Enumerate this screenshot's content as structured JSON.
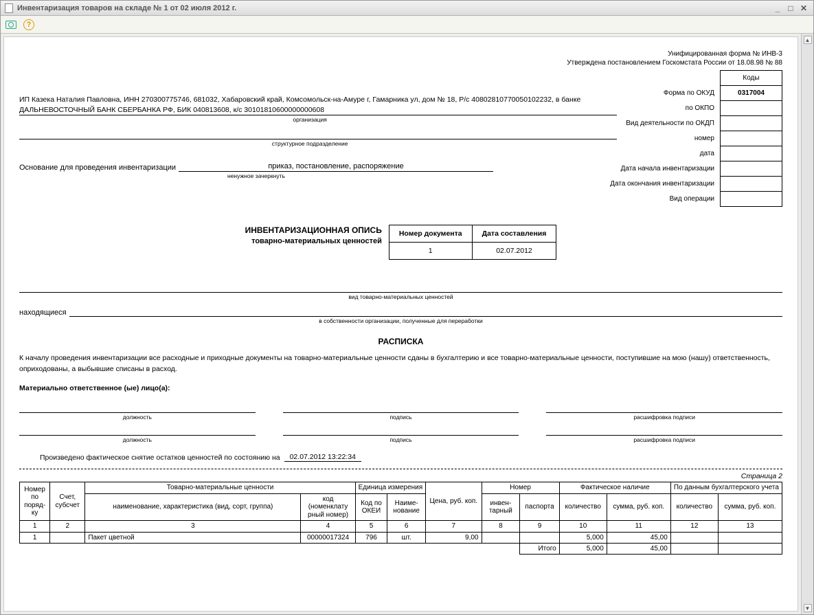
{
  "window": {
    "title": "Инвентаризация товаров на складе № 1 от 02 июля 2012 г."
  },
  "header": {
    "form_line1": "Унифицированная форма № ИНВ-3",
    "form_line2": "Утверждена постановлением Госкомстата России от 18.08.98 № 88"
  },
  "codes": {
    "title": "Коды",
    "okud_label": "Форма по ОКУД",
    "okud": "0317004",
    "okpo_label": "по ОКПО",
    "okpo": "",
    "okdp_label": "Вид деятельности по ОКДП",
    "okdp": "",
    "number_label": "номер",
    "number": "",
    "date_label": "дата",
    "date": "",
    "start_label": "Дата начала инвентаризации",
    "start": "",
    "end_label": "Дата окончания инвентаризации",
    "end": "",
    "oper_label": "Вид операции",
    "oper": ""
  },
  "org": {
    "text": "ИП Казека Наталия Павловна, ИНН 270300775746, 681032, Хабаровский край, Комсомольск-на-Амуре г, Гамарника ул, дом № 18, Р/с 40802810770050102232, в банке ДАЛЬНЕВОСТОЧНЫЙ БАНК СБЕРБАНКА РФ, БИК 040813608, к/с 30101810600000000608",
    "org_cap": "организация",
    "dept_cap": "структурное подразделение"
  },
  "basis": {
    "label": "Основание для проведения инвентаризации",
    "value": "приказ, постановление, распоряжение",
    "cap": "ненужное зачеркнуть"
  },
  "doc_head": {
    "title": "ИНВЕНТАРИЗАЦИОННАЯ ОПИСЬ",
    "subtitle": "товарно-материальных ценностей",
    "num_hdr": "Номер документа",
    "date_hdr": "Дата составления",
    "num": "1",
    "date": "02.07.2012"
  },
  "mid": {
    "type_cap": "вид товарно-материальных ценностей",
    "located": "находящиеся",
    "located_cap": "в собственности организации, полученные для переработки"
  },
  "raspiska": {
    "title": "РАСПИСКА",
    "text": "К началу проведения инвентаризации все расходные и приходные документы на товарно-материальные ценности сданы в бухгалтерию и все товарно-материальные ценности, поступившие на мою (нашу) ответственность, оприходованы, а выбывшие списаны в расход.",
    "resp_label": "Материально ответственное (ые) лицо(а):",
    "pos_cap": "должность",
    "sign_cap": "подпись",
    "name_cap": "расшифровка подписи",
    "state_label": "Произведено фактическое снятие остатков ценностей по состоянию на",
    "state_value": "02.07.2012 13:22:34"
  },
  "page_label": "Страница 2",
  "table": {
    "headers": {
      "num": "Номер по поряд- ку",
      "account": "Счет, субсчет",
      "tmc": "Товарно-материальные ценности",
      "name": "наименование, характеристика (вид, сорт, группа)",
      "code": "код (номенклату рный номер)",
      "unit": "Единица измерения",
      "okei": "Код по ОКЕИ",
      "unit_name": "Наиме- нование",
      "price": "Цена, руб. коп.",
      "number_grp": "Номер",
      "inv": "инвен- тарный",
      "passport": "паспорта",
      "fact": "Фактическое наличие",
      "book": "По данным бухгалтерского учета",
      "qty": "количество",
      "sum": "сумма, руб. коп."
    },
    "colnums": [
      "1",
      "2",
      "3",
      "4",
      "5",
      "6",
      "7",
      "8",
      "9",
      "10",
      "11",
      "12",
      "13"
    ],
    "rows": [
      {
        "n": "1",
        "acc": "",
        "name": "Пакет цветной",
        "code": "00000017324",
        "okei": "796",
        "unit": "шт.",
        "price": "9,00",
        "inv": "",
        "pass": "",
        "fqty": "5,000",
        "fsum": "45,00",
        "bqty": "",
        "bsum": ""
      }
    ],
    "totals": {
      "label": "Итого",
      "fqty": "5,000",
      "fsum": "45,00",
      "bqty": "",
      "bsum": ""
    }
  }
}
